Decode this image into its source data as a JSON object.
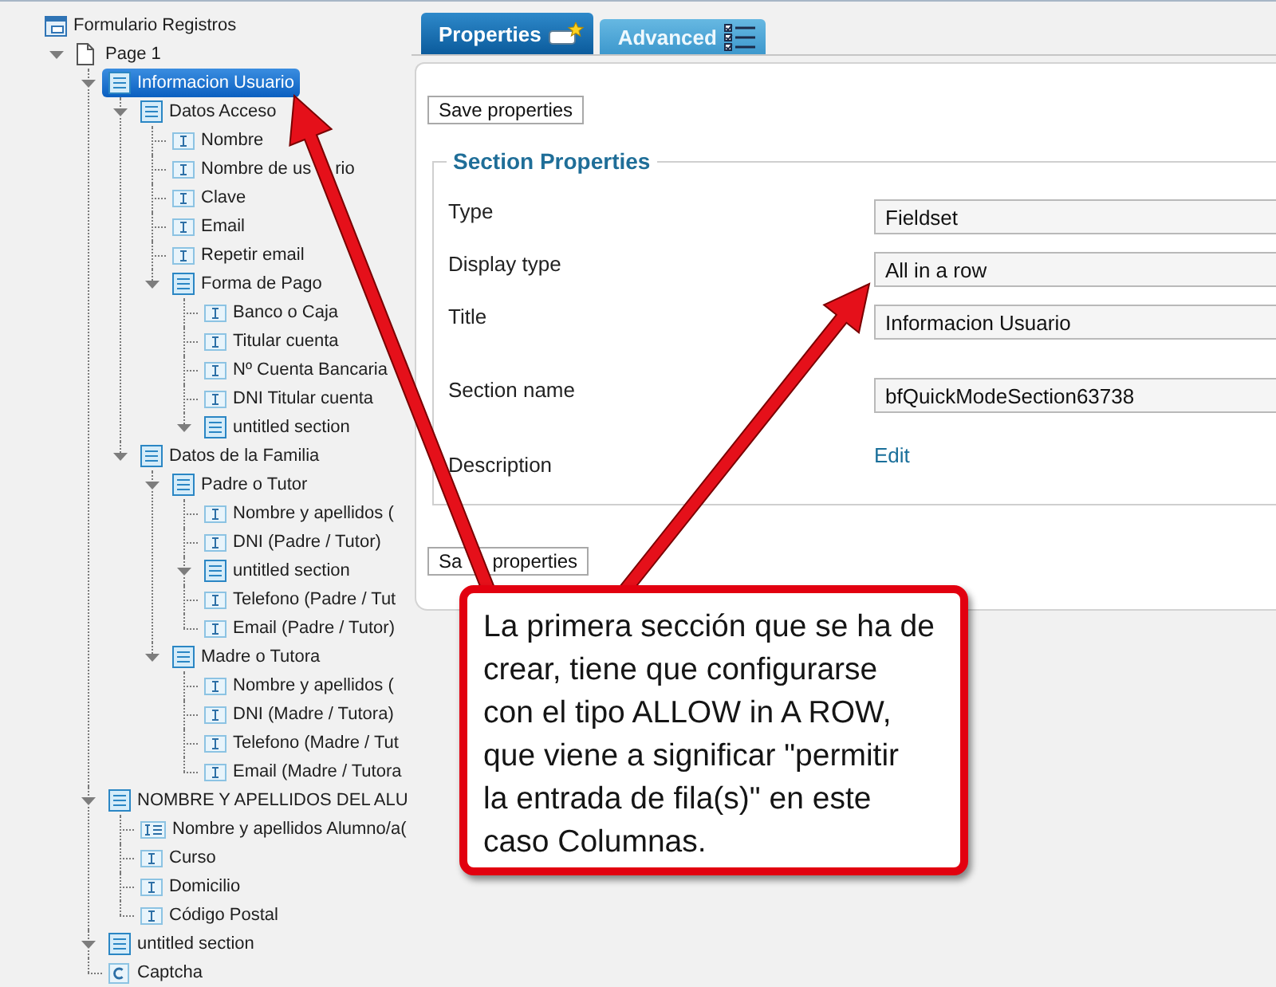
{
  "tree": {
    "label": "Formulario Registros",
    "kind": "form",
    "selected": false,
    "children": [
      {
        "label": "Page 1",
        "kind": "page",
        "expanded": true,
        "selected": false,
        "children": [
          {
            "label": "Informacion Usuario",
            "kind": "section",
            "expanded": true,
            "selected": true,
            "children": [
              {
                "label": "Datos Acceso",
                "kind": "section",
                "expanded": true,
                "selected": false,
                "children": [
                  {
                    "label": "Nombre",
                    "kind": "field",
                    "selected": false
                  },
                  {
                    "label": [
                      "Nombre de us",
                      "rio"
                    ],
                    "kind": "field",
                    "selected": false
                  },
                  {
                    "label": "Clave",
                    "kind": "field",
                    "selected": false
                  },
                  {
                    "label": "Email",
                    "kind": "field",
                    "selected": false
                  },
                  {
                    "label": "Repetir email",
                    "kind": "field",
                    "selected": false
                  },
                  {
                    "label": "Forma de Pago",
                    "kind": "section",
                    "expanded": true,
                    "selected": false,
                    "children": [
                      {
                        "label": "Banco o Caja",
                        "kind": "field",
                        "selected": false
                      },
                      {
                        "label": "Titular cuenta",
                        "kind": "field",
                        "selected": false
                      },
                      {
                        "label": "Nº Cuenta Bancaria",
                        "kind": "field",
                        "selected": false
                      },
                      {
                        "label": "DNI Titular cuenta",
                        "kind": "field",
                        "selected": false
                      },
                      {
                        "label": "untitled section",
                        "kind": "section",
                        "expanded": true,
                        "selected": false
                      }
                    ]
                  }
                ]
              },
              {
                "label": "Datos de la Familia",
                "kind": "section",
                "expanded": true,
                "selected": false,
                "children": [
                  {
                    "label": "Padre o Tutor",
                    "kind": "section",
                    "expanded": true,
                    "selected": false,
                    "children": [
                      {
                        "label": "Nombre y apellidos (",
                        "kind": "field",
                        "selected": false
                      },
                      {
                        "label": "DNI (Padre / Tutor)",
                        "kind": "field",
                        "selected": false
                      },
                      {
                        "label": "untitled section",
                        "kind": "section",
                        "expanded": true,
                        "selected": false
                      },
                      {
                        "label": "Telefono (Padre / Tut",
                        "kind": "field",
                        "selected": false
                      },
                      {
                        "label": "Email (Padre / Tutor)",
                        "kind": "field",
                        "selected": false
                      }
                    ]
                  },
                  {
                    "label": "Madre o Tutora",
                    "kind": "section",
                    "expanded": true,
                    "selected": false,
                    "children": [
                      {
                        "label": "Nombre y apellidos (",
                        "kind": "field",
                        "selected": false
                      },
                      {
                        "label": "DNI (Madre / Tutora)",
                        "kind": "field",
                        "selected": false
                      },
                      {
                        "label": "Telefono (Madre / Tut",
                        "kind": "field",
                        "selected": false
                      },
                      {
                        "label": "Email (Madre / Tutora",
                        "kind": "field",
                        "selected": false
                      }
                    ]
                  }
                ]
              }
            ]
          },
          {
            "label": "NOMBRE Y APELLIDOS DEL ALU",
            "kind": "section",
            "expanded": true,
            "selected": false,
            "children": [
              {
                "label": "Nombre y apellidos Alumno/a(",
                "kind": "multifield",
                "selected": false
              },
              {
                "label": "Curso",
                "kind": "field",
                "selected": false
              },
              {
                "label": "Domicilio",
                "kind": "field",
                "selected": false
              },
              {
                "label": "Código Postal",
                "kind": "field",
                "selected": false
              }
            ]
          },
          {
            "label": "untitled section",
            "kind": "section",
            "expanded": true,
            "selected": false
          },
          {
            "label": "Captcha",
            "kind": "captcha",
            "selected": false
          }
        ]
      }
    ]
  },
  "tabs": [
    {
      "label": "Properties",
      "selected": true
    },
    {
      "label": "Advanced",
      "selected": false
    }
  ],
  "panel": {
    "save_button_top": "Save properties",
    "fieldset": {
      "legend": "Section Properties",
      "rows": [
        {
          "label": "Type",
          "kind": "field",
          "value": "Fieldset"
        },
        {
          "label": "Display type",
          "kind": "field",
          "value": "All in a row"
        },
        {
          "label": "Title",
          "kind": "field",
          "value": "Informacion Usuario"
        },
        {
          "label": "Section name",
          "kind": "field",
          "value": "bfQuickModeSection63738"
        },
        {
          "label": "Description",
          "kind": "link",
          "value": "Edit"
        }
      ]
    },
    "save_button_bottom": [
      "Sa",
      "properties"
    ]
  },
  "callout": {
    "text": "La primera sección que se ha de\ncrear, tiene que configurarse\ncon el tipo ALLOW in A ROW,\nque viene a significar \"permitir\nla entrada de fila(s)\" en este\ncaso Columnas."
  }
}
